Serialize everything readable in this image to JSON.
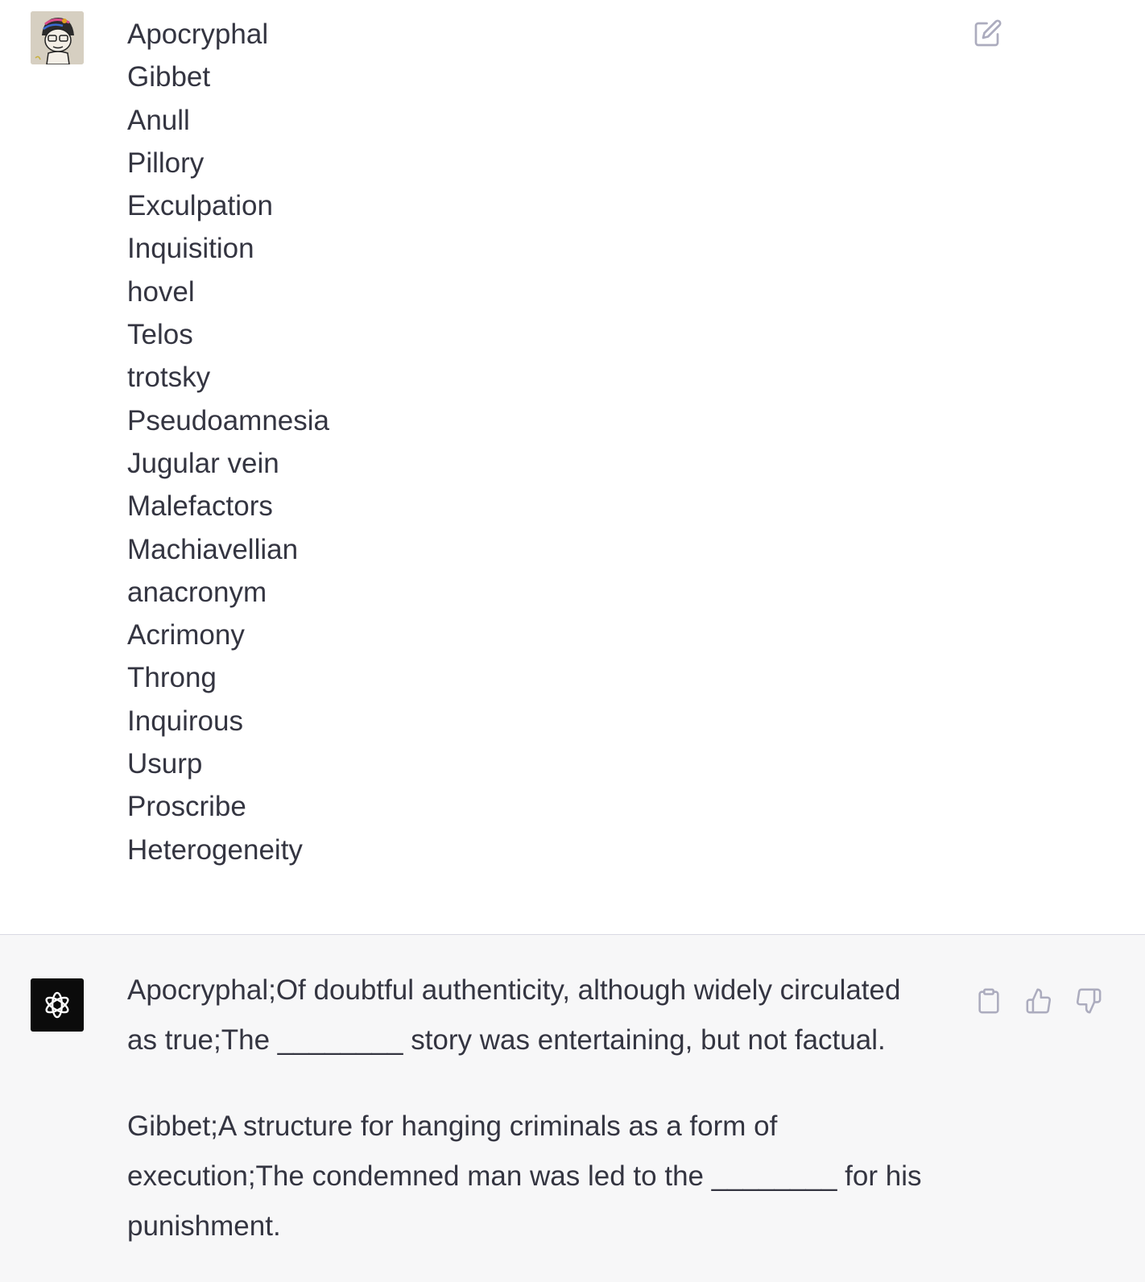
{
  "user_message": {
    "words": [
      "Apocryphal",
      "Gibbet",
      "Anull",
      "Pillory",
      "Exculpation",
      "Inquisition",
      "hovel",
      "Telos",
      "trotsky",
      "Pseudoamnesia",
      "Jugular vein",
      "Malefactors",
      "Machiavellian",
      "anacronym",
      "Acrimony",
      "Throng",
      "Inquirous",
      "Usurp",
      "Proscribe",
      "Heterogeneity"
    ],
    "edit_icon": "pencil-square-icon"
  },
  "assistant_message": {
    "paragraphs": [
      "Apocryphal;Of doubtful authenticity, although widely circulated as true;The ________ story was entertaining, but not factual.",
      "Gibbet;A structure for hanging criminals as a form of execution;The condemned man was led to the ________ for his punishment."
    ],
    "icons": [
      "openai-logo-icon",
      "clipboard-icon",
      "thumbs-up-icon",
      "thumbs-down-icon"
    ]
  },
  "colors": {
    "text": "#343541",
    "assistant_bg": "#f7f7f8",
    "divider": "#d9d9e3",
    "icon": "#acacbe"
  }
}
